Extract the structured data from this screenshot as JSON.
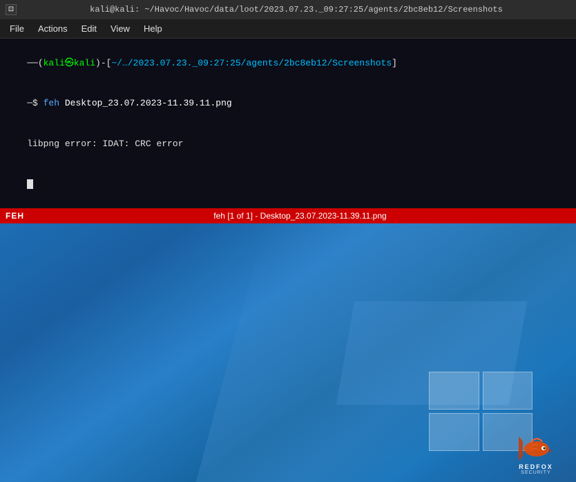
{
  "titlebar": {
    "icon": "⊡",
    "text": "kali@kali: ~/Havoc/Havoc/data/loot/2023.07.23._09:27:25/agents/2bc8eb12/Screenshots"
  },
  "menubar": {
    "items": [
      "File",
      "Actions",
      "Edit",
      "View",
      "Help"
    ]
  },
  "terminal": {
    "prompt_line": "──(kali㉿kali)-[~/…/2023.07.23._09:27:25/agents/2bc8eb12/Screenshots]",
    "command_prefix": "$ ",
    "command_tool": "feh ",
    "command_file": "Desktop_23.07.2023-11.39.11.png",
    "error_line": "libpng error: IDAT: CRC error"
  },
  "feh_statusbar": {
    "label": "FEH",
    "title": "feh [1 of 1] - Desktop_23.07.2023-11.39.11.png"
  },
  "redfox": {
    "brand": "REDFOX",
    "subtitle": "SECURITY"
  }
}
